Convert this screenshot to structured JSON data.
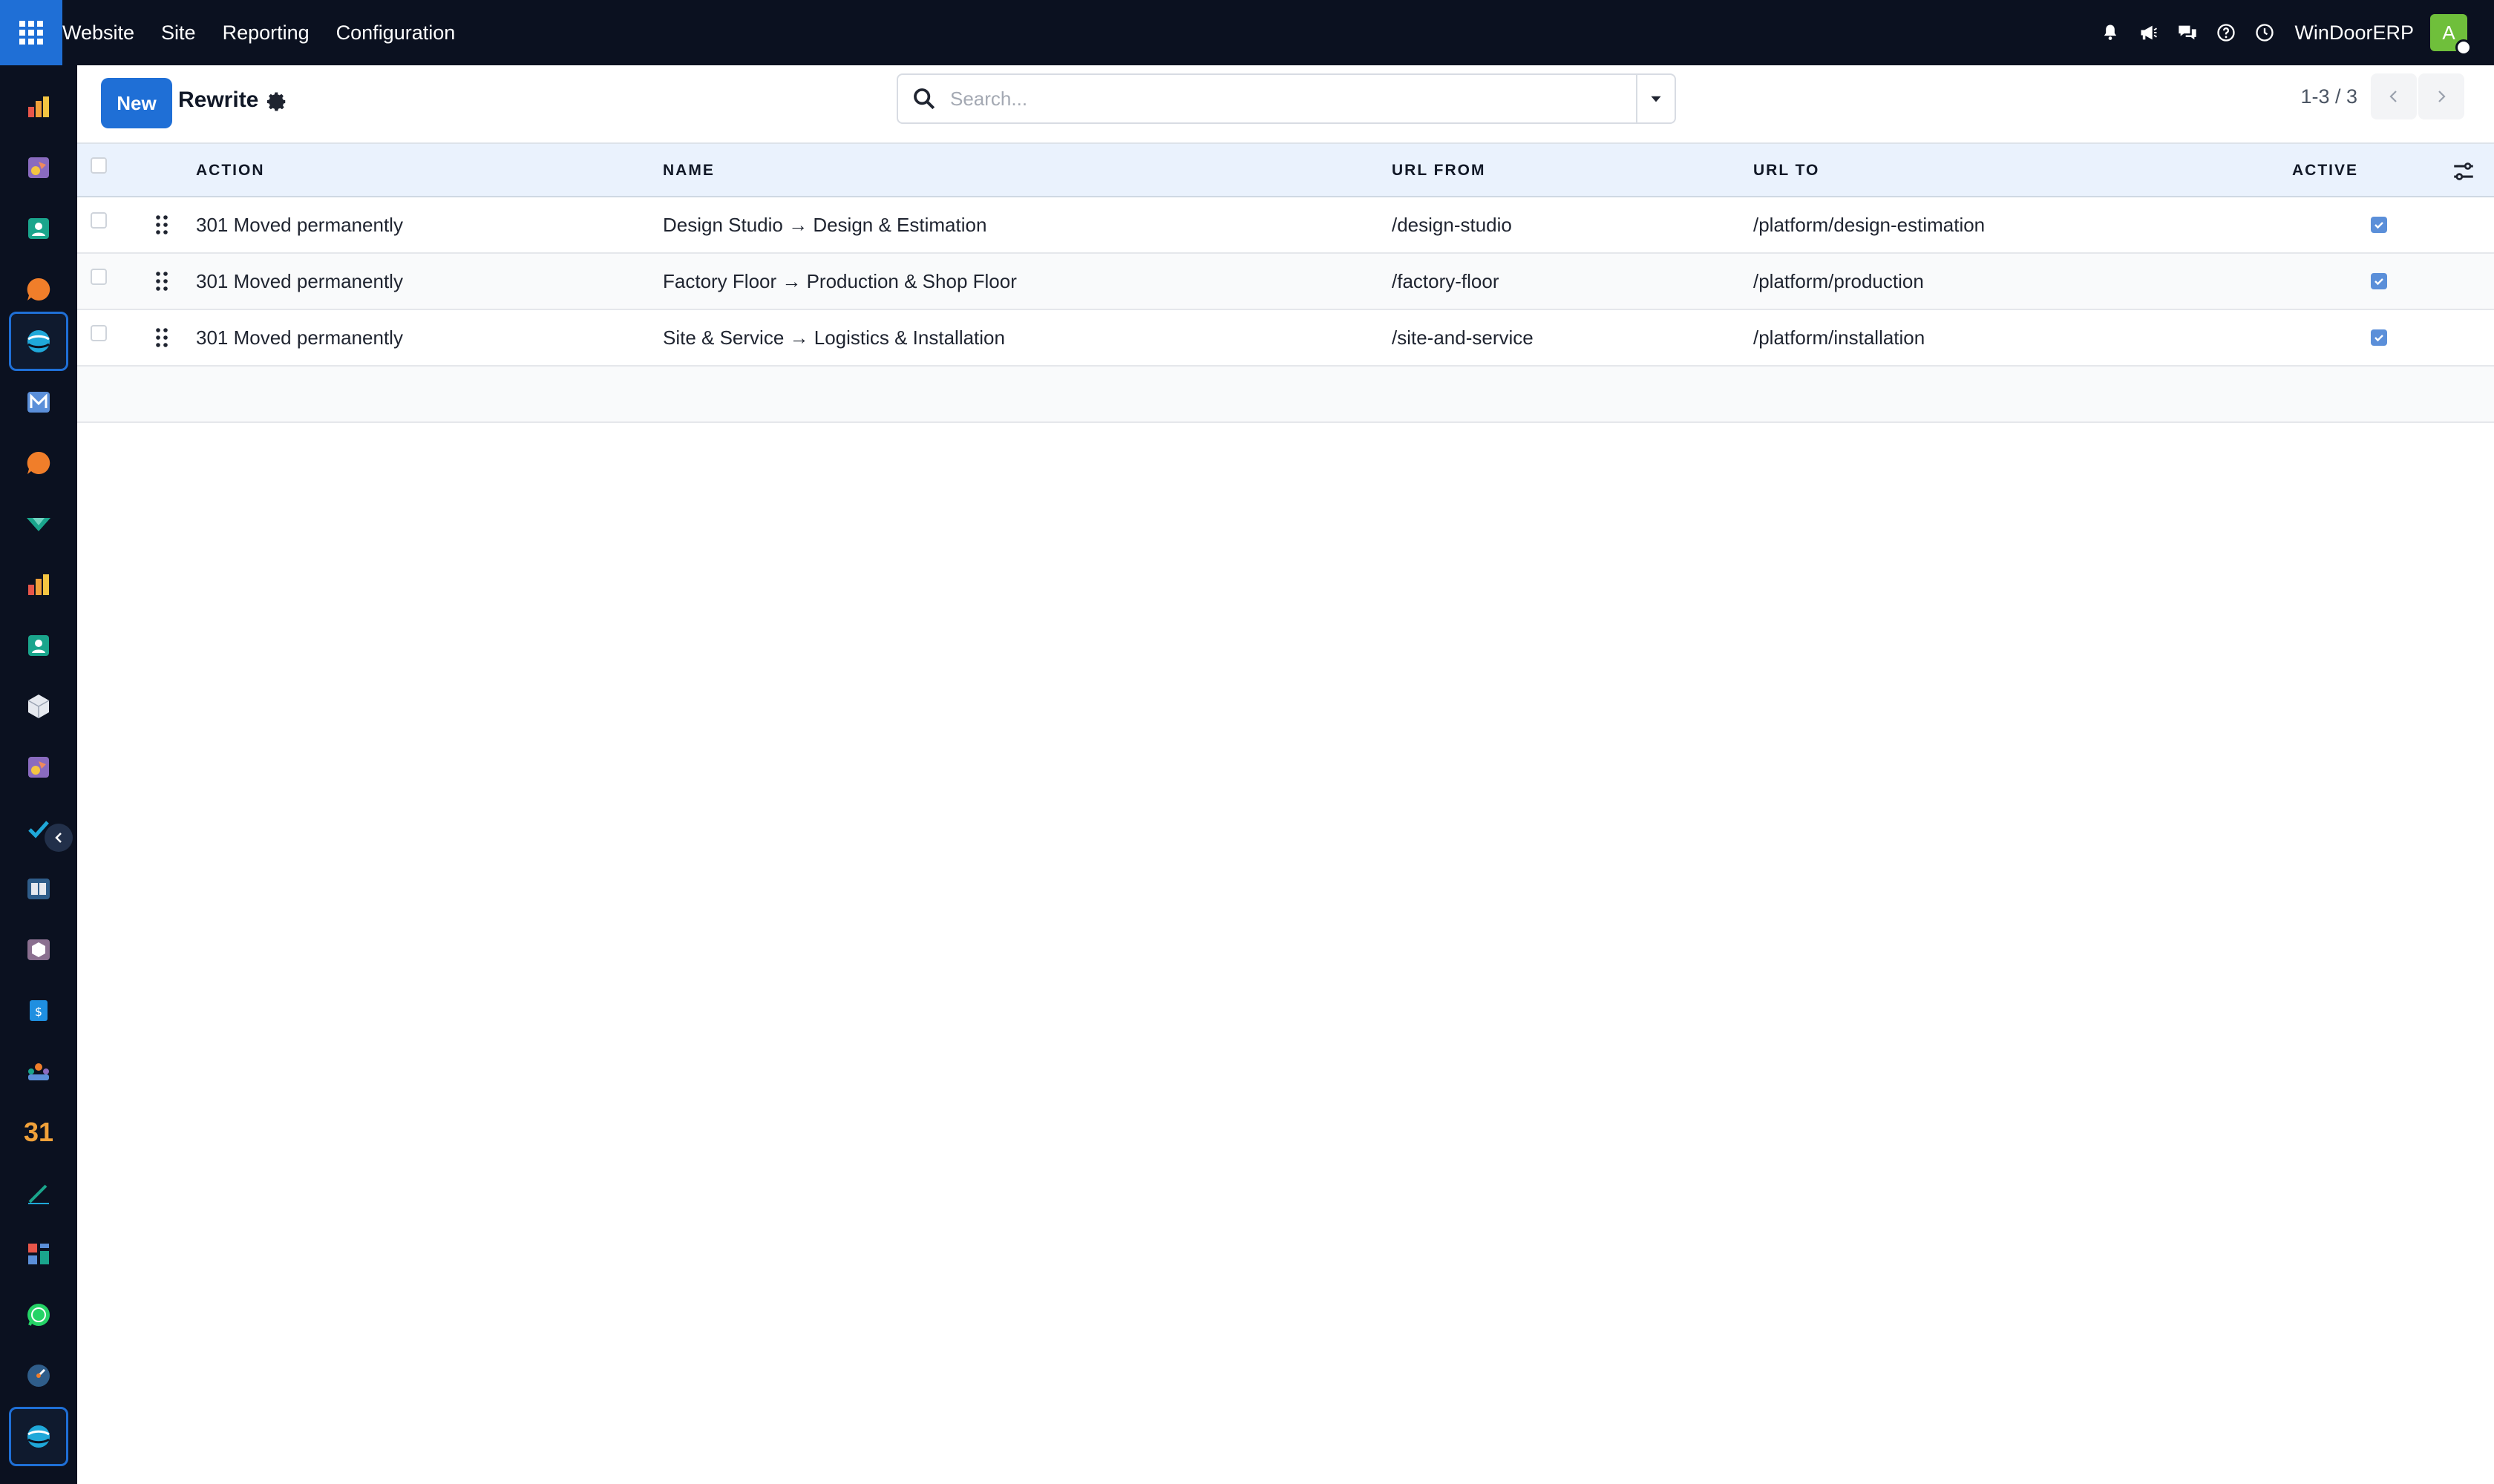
{
  "navbar": {
    "menu": [
      "Website",
      "Site",
      "Reporting",
      "Configuration"
    ],
    "company": "WinDoorERP",
    "avatar_letter": "A",
    "icons": [
      "bell-icon",
      "megaphone-icon",
      "chat-icon",
      "help-icon",
      "clock-icon"
    ]
  },
  "sidebar": {
    "apps": [
      "dashboard-app-icon",
      "creative-app-icon",
      "contacts-app-icon",
      "livechat-app-icon",
      "website-app-icon",
      "email-marketing-app-icon",
      "discuss-app-icon",
      "surveys-app-icon",
      "reporting-app-icon",
      "employees-app-icon",
      "inventory-app-icon",
      "studio-app-icon",
      "project-app-icon",
      "knowledge-app-icon",
      "products-app-icon",
      "invoicing-app-icon",
      "team-app-icon",
      "calendar-app-icon",
      "sign-app-icon",
      "apps-app-icon",
      "whatsapp-app-icon",
      "timesheet-app-icon",
      "website-app-icon"
    ],
    "calendar_label": "31"
  },
  "control": {
    "new_label": "New",
    "title": "Rewrite",
    "search_placeholder": "Search...",
    "pager": "1-3 / 3"
  },
  "table": {
    "headers": {
      "action": "ACTION",
      "name": "NAME",
      "url_from": "URL FROM",
      "url_to": "URL TO",
      "active": "ACTIVE"
    },
    "rows": [
      {
        "action": "301 Moved permanently",
        "name": "Design Studio → Design & Estimation",
        "url_from": "/design-studio",
        "url_to": "/platform/design-estimation",
        "active": true
      },
      {
        "action": "301 Moved permanently",
        "name": "Factory Floor → Production & Shop Floor",
        "url_from": "/factory-floor",
        "url_to": "/platform/production",
        "active": true
      },
      {
        "action": "301 Moved permanently",
        "name": "Site & Service → Logistics & Installation",
        "url_from": "/site-and-service",
        "url_to": "/platform/installation",
        "active": true
      }
    ]
  },
  "colors": {
    "navbar": "#0b1120",
    "primary": "#1f6fd6",
    "header_bg": "#eaf2fd",
    "checked": "#5b8fd9"
  }
}
